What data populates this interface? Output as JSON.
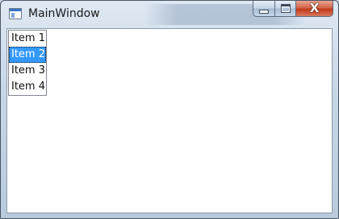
{
  "window": {
    "title": "MainWindow",
    "icons": {
      "app": "window-app-icon",
      "minimize": "minimize-icon",
      "maximize": "maximize-icon",
      "close": "close-icon"
    },
    "close_glyph": "X"
  },
  "listbox": {
    "items": [
      {
        "label": "Item 1",
        "selected": false
      },
      {
        "label": "Item 2",
        "selected": true
      },
      {
        "label": "Item 3",
        "selected": false
      },
      {
        "label": "Item 4",
        "selected": false
      }
    ],
    "selected_index": 1
  },
  "colors": {
    "selection": "#3399ff",
    "close_button": "#c4391a",
    "client_background": "#ffffff"
  }
}
